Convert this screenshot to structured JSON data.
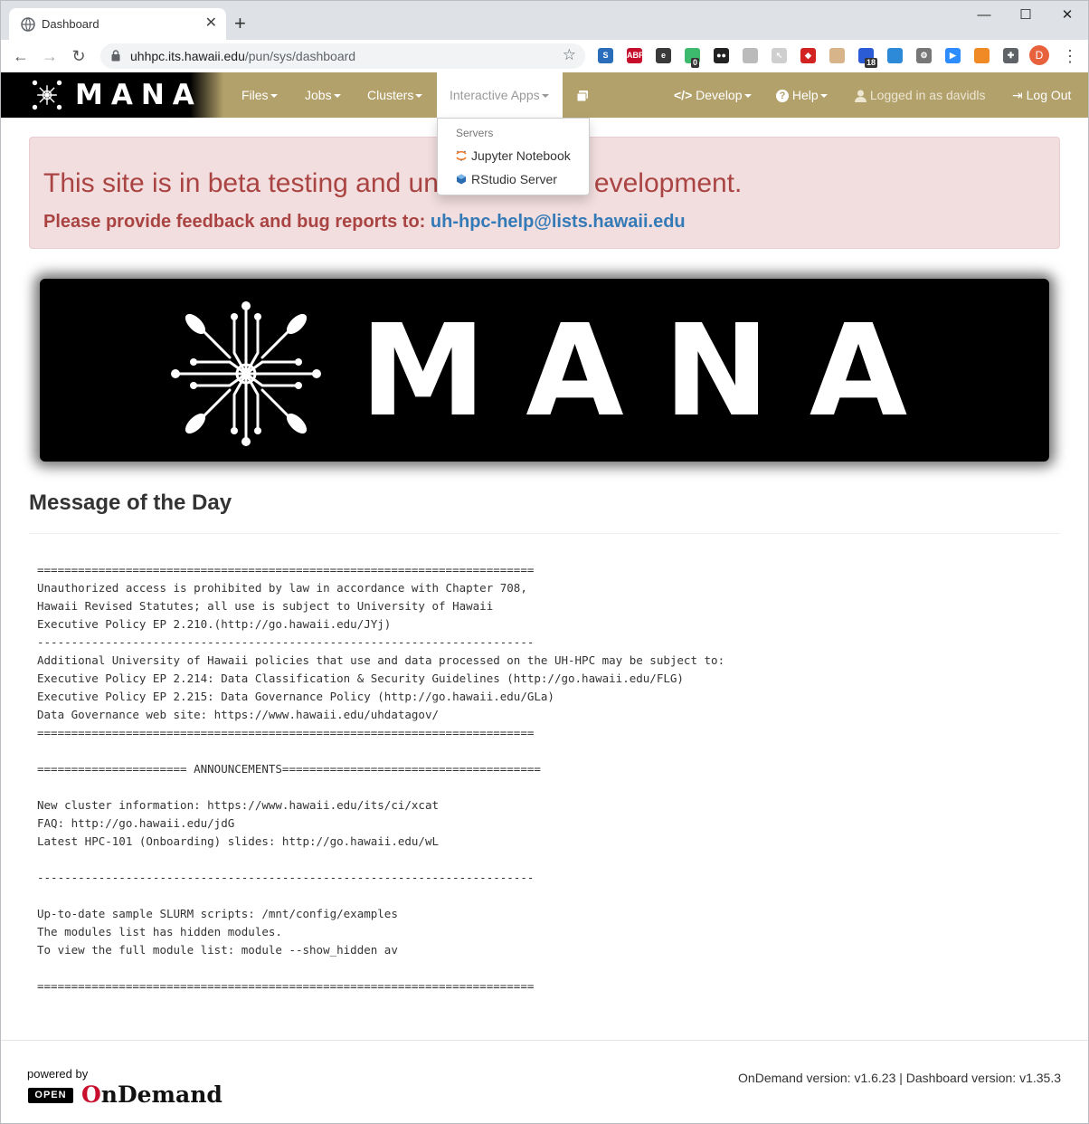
{
  "browser": {
    "tab_title": "Dashboard",
    "tab_close": "✕",
    "new_tab": "+",
    "url_host": "uhhpc.its.hawaii.edu",
    "url_path": "/pun/sys/dashboard",
    "window_controls": {
      "minimize": "—",
      "maximize": "☐",
      "close": "✕"
    },
    "extensions": [
      {
        "name": "s-ext-icon",
        "label": "S",
        "color": "#2a6ebb"
      },
      {
        "name": "adblock-plus-icon",
        "label": "ABP",
        "color": "#c70d2c"
      },
      {
        "name": "e-ext-icon",
        "label": "e",
        "color": "#3a3a3a"
      },
      {
        "name": "green-ext-icon",
        "label": "",
        "color": "#3dba6d",
        "badge": "0"
      },
      {
        "name": "mask-ext-icon",
        "label": "●●",
        "color": "#222222"
      },
      {
        "name": "grey-circle-ext-icon",
        "label": "",
        "color": "#bbbbbb"
      },
      {
        "name": "cursor-ext-icon",
        "label": "↖",
        "color": "#cfcfcf"
      },
      {
        "name": "red-diamond-ext-icon",
        "label": "◆",
        "color": "#d32222"
      },
      {
        "name": "face-ext-icon",
        "label": "",
        "color": "#d8b48a"
      },
      {
        "name": "calendar-ext-icon",
        "label": "",
        "color": "#2c5bd6",
        "badge": "18"
      },
      {
        "name": "blue-window-ext-icon",
        "label": "",
        "color": "#2d8ad8"
      },
      {
        "name": "gear-ext-icon",
        "label": "⚙",
        "color": "#777777"
      },
      {
        "name": "zoom-ext-icon",
        "label": "▶",
        "color": "#2d8cff"
      },
      {
        "name": "rss-ext-icon",
        "label": "",
        "color": "#f08a24"
      },
      {
        "name": "puzzle-icon",
        "label": "✚",
        "color": "#5f6368"
      }
    ],
    "profile_initial": "D",
    "menu_icon": "⋮"
  },
  "navbar": {
    "brand": "MANA",
    "items": [
      {
        "label": "Files",
        "caret": true
      },
      {
        "label": "Jobs",
        "caret": true
      },
      {
        "label": "Clusters",
        "caret": true
      },
      {
        "label": "Interactive Apps",
        "caret": true
      },
      {
        "label": "Develop",
        "caret": true
      },
      {
        "label": "Help",
        "caret": true
      },
      {
        "label": "Logged in as davidls",
        "caret": false
      },
      {
        "label": "Log Out",
        "caret": false
      }
    ]
  },
  "dropdown": {
    "header": "Servers",
    "items": [
      {
        "label": "Jupyter Notebook",
        "icon": "jupyter-icon"
      },
      {
        "label": "RStudio Server",
        "icon": "rstudio-icon"
      }
    ]
  },
  "alert": {
    "line1_visible_left": "This site is in beta testing and un",
    "line1_visible_right": "evelopment.",
    "line2_prefix": "Please provide feedback and bug reports to: ",
    "line2_link": "uh-hpc-help@lists.hawaii.edu"
  },
  "banner": {
    "text": "MANA"
  },
  "motd": {
    "title": "Message of the Day",
    "body": "=========================================================================\nUnauthorized access is prohibited by law in accordance with Chapter 708,\nHawaii Revised Statutes; all use is subject to University of Hawaii\nExecutive Policy EP 2.210.(http://go.hawaii.edu/JYj)\n-------------------------------------------------------------------------\nAdditional University of Hawaii policies that use and data processed on the UH-HPC may be subject to:\nExecutive Policy EP 2.214: Data Classification & Security Guidelines (http://go.hawaii.edu/FLG)\nExecutive Policy EP 2.215: Data Governance Policy (http://go.hawaii.edu/GLa)\nData Governance web site: https://www.hawaii.edu/uhdatagov/\n=========================================================================\n\n====================== ANNOUNCEMENTS======================================\n\nNew cluster information: https://www.hawaii.edu/its/ci/xcat\nFAQ: http://go.hawaii.edu/jdG\nLatest HPC-101 (Onboarding) slides: http://go.hawaii.edu/wL\n\n-------------------------------------------------------------------------\n\nUp-to-date sample SLURM scripts: /mnt/config/examples\nThe modules list has hidden modules.\nTo view the full module list: module --show_hidden av\n\n========================================================================="
  },
  "footer": {
    "powered_by": "powered by",
    "open_badge": "OPEN",
    "ondemand_o": "O",
    "ondemand_rest": "nDemand",
    "versions": "OnDemand version: v1.6.23 | Dashboard version: v1.35.3"
  }
}
